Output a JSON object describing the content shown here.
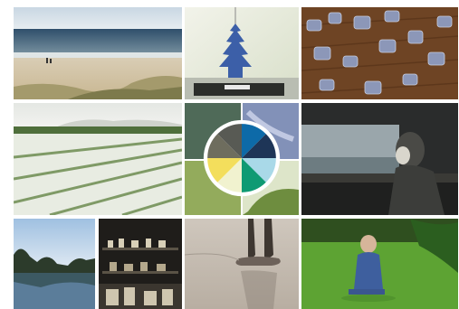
{
  "collage": {
    "tiles": [
      {
        "name": "beach-dunes-photo"
      },
      {
        "name": "tree-air-freshener-photo"
      },
      {
        "name": "puzzle-pieces-photo"
      },
      {
        "name": "white-flower-field-photo"
      },
      {
        "name": "color-harmony-photo"
      },
      {
        "name": "person-at-window-photo"
      },
      {
        "name": "lake-trees-photo"
      },
      {
        "name": "shop-shelves-photo"
      },
      {
        "name": "feet-in-water-photo"
      },
      {
        "name": "child-on-grass-photo"
      }
    ]
  },
  "color_wheel": {
    "segments": [
      "#0d6aa8",
      "#1e3557",
      "#a9d9e8",
      "#0f9a73",
      "#f1f2cf",
      "#f3de5c",
      "#6e6d5e",
      "#585a54"
    ]
  }
}
